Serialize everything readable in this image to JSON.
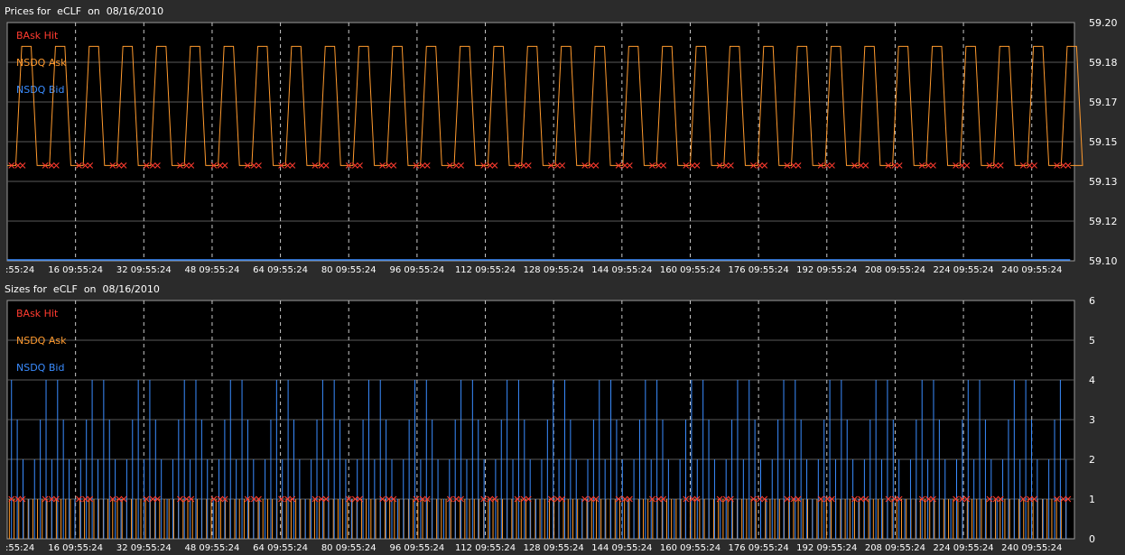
{
  "chart_data": [
    {
      "type": "line",
      "title": "Prices for  eCLF  on  08/16/2010",
      "legend": [
        "BAsk Hit",
        "NSDQ Ask",
        "NSDQ Bid"
      ],
      "legend_position": "top-left",
      "colors": {
        "BAsk Hit": "#ff3b2f",
        "NSDQ Ask": "#ff9a2e",
        "NSDQ Bid": "#3a8cff"
      },
      "x_tick_labels": [
        ":55:24",
        "16 09:55:24",
        "32 09:55:24",
        "48 09:55:24",
        "64 09:55:24",
        "80 09:55:24",
        "96 09:55:24",
        "112 09:55:24",
        "128 09:55:24",
        "144 09:55:24",
        "160 09:55:24",
        "176 09:55:24",
        "192 09:55:24",
        "208 09:55:24",
        "224 09:55:24",
        "240 09:55:24"
      ],
      "x_tick_values": [
        0,
        16,
        32,
        48,
        64,
        80,
        96,
        112,
        128,
        144,
        160,
        176,
        192,
        208,
        224,
        240
      ],
      "xlim": [
        0,
        250
      ],
      "y_tick_labels": [
        "59.20",
        "59.18",
        "59.17",
        "59.15",
        "59.13",
        "59.12",
        "59.10"
      ],
      "ylim": [
        59.1,
        59.2
      ],
      "grid": true,
      "series": [
        {
          "name": "NSDQ Ask",
          "style": "oscillating",
          "high": 59.19,
          "low": 59.14
        },
        {
          "name": "BAsk Hit",
          "style": "markers",
          "value": 59.14
        },
        {
          "name": "NSDQ Bid",
          "style": "flat",
          "value": 59.1
        }
      ]
    },
    {
      "type": "bar",
      "title": "Sizes for  eCLF  on  08/16/2010",
      "legend": [
        "BAsk Hit",
        "NSDQ Ask",
        "NSDQ Bid"
      ],
      "legend_position": "top-left",
      "colors": {
        "BAsk Hit": "#ff3b2f",
        "NSDQ Ask": "#ff9a2e",
        "NSDQ Bid": "#3a8cff"
      },
      "x_tick_labels": [
        ":55:24",
        "16 09:55:24",
        "32 09:55:24",
        "48 09:55:24",
        "64 09:55:24",
        "80 09:55:24",
        "96 09:55:24",
        "112 09:55:24",
        "128 09:55:24",
        "144 09:55:24",
        "160 09:55:24",
        "176 09:55:24",
        "192 09:55:24",
        "208 09:55:24",
        "224 09:55:24",
        "240 09:55:24"
      ],
      "x_tick_values": [
        0,
        16,
        32,
        48,
        64,
        80,
        96,
        112,
        128,
        144,
        160,
        176,
        192,
        208,
        224,
        240
      ],
      "xlim": [
        0,
        250
      ],
      "y_tick_labels": [
        "6",
        "5",
        "4",
        "3",
        "2",
        "1",
        "0"
      ],
      "ylim": [
        0,
        6
      ],
      "grid": true,
      "series": [
        {
          "name": "NSDQ Ask",
          "style": "spikes",
          "value": 1
        },
        {
          "name": "BAsk Hit",
          "style": "markers",
          "value": 1
        },
        {
          "name": "NSDQ Bid",
          "style": "spikes",
          "pattern": [
            4,
            3,
            2,
            1,
            2,
            3,
            4,
            2
          ]
        }
      ]
    }
  ]
}
